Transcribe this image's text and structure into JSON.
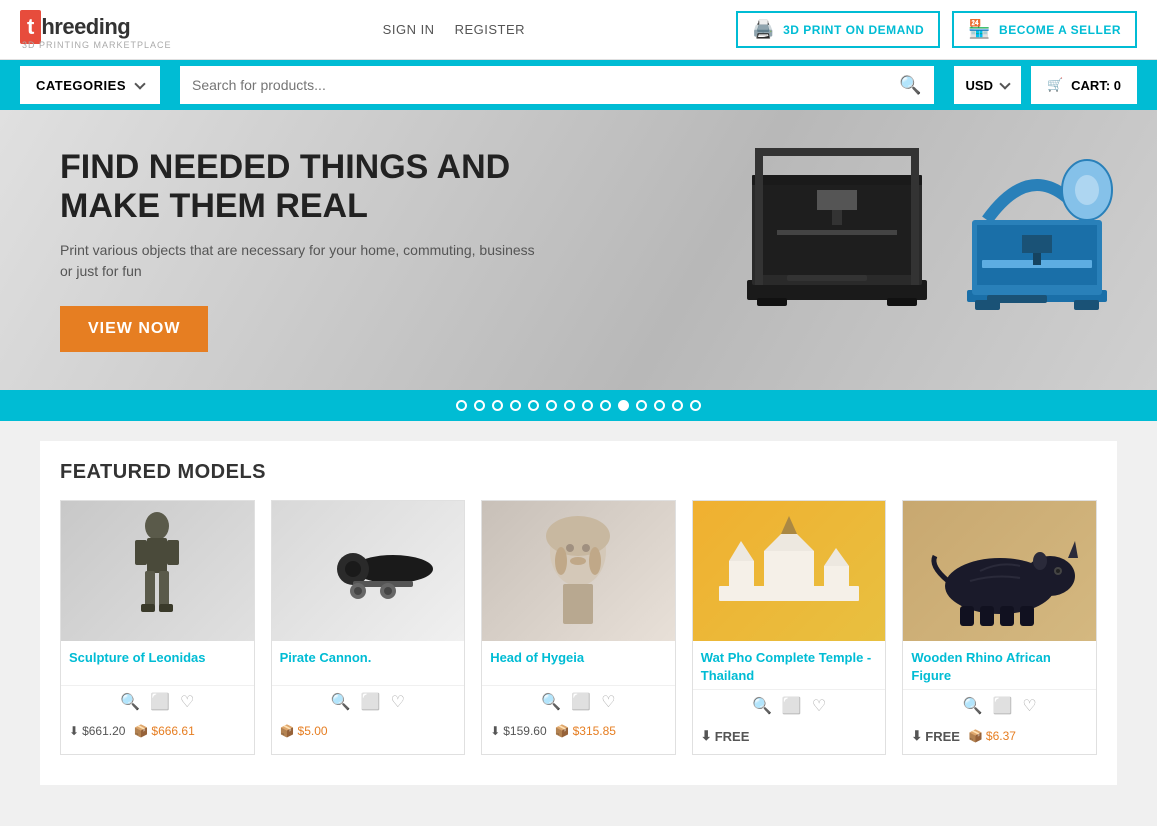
{
  "header": {
    "logo_letter": "t",
    "logo_name": "hreeding",
    "logo_tagline": "3D PRINTING MARKETPLACE",
    "signin": "SIGN IN",
    "register": "REGISTER",
    "print_on_demand": "3D PRINT ON DEMAND",
    "become_seller": "BECOME A SELLER"
  },
  "navbar": {
    "categories": "CATEGORIES",
    "search_placeholder": "Search for products...",
    "currency": "USD",
    "cart": "CART: 0"
  },
  "hero": {
    "title": "FIND NEEDED THINGS AND MAKE THEM REAL",
    "subtitle": "Print various objects that are necessary for your home, commuting, business or just for fun",
    "cta": "VIEW NOW"
  },
  "slider": {
    "total_dots": 14,
    "active_dot": 9
  },
  "featured": {
    "title": "FEATURED MODELS",
    "products": [
      {
        "name": "Sculpture of Leonidas",
        "price_download": "$661.20",
        "price_print": "$666.61",
        "bg_color": "#c0c0c0",
        "emoji": "🗿"
      },
      {
        "name": "Pirate Cannon.",
        "price_download": "",
        "price_print": "$5.00",
        "bg_color": "#d8d8d8",
        "emoji": "💣"
      },
      {
        "name": "Head of Hygeia",
        "price_download": "$159.60",
        "price_print": "$315.85",
        "bg_color": "#c8c0b8",
        "emoji": "🏛️"
      },
      {
        "name": "Wat Pho Complete Temple - Thailand",
        "price_download": "FREE",
        "price_print": "",
        "bg_color": "#f0b030",
        "emoji": "⛩️"
      },
      {
        "name": "Wooden Rhino African Figure",
        "price_download": "FREE",
        "price_print": "$6.37",
        "bg_color": "#c8a870",
        "emoji": "🦏"
      }
    ]
  }
}
